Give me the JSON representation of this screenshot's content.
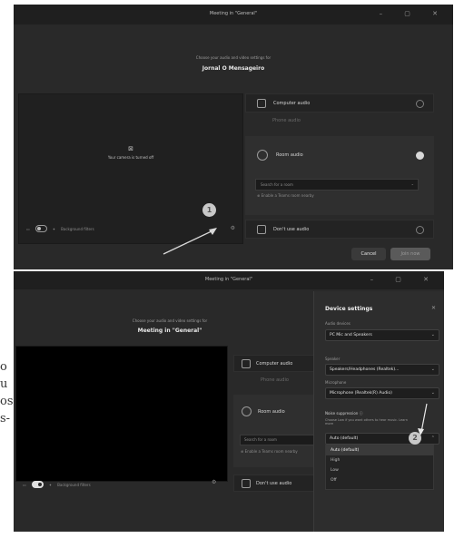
{
  "top": {
    "title": "Meeting in \"General\"",
    "window_buttons": "–  ▢  ✕",
    "subtitle": "Choose your audio and video settings for",
    "meeting_name": "Jornal O Mensageiro",
    "camera_off": "Your camera is turned off",
    "background_filters": "Background filters",
    "options": [
      {
        "label": "Computer audio",
        "selected": false
      },
      {
        "label": "Phone audio",
        "selected": false,
        "faded": true
      },
      {
        "label": "Room audio",
        "selected": true
      },
      {
        "label": "Don't use audio",
        "selected": false
      }
    ],
    "search_room_placeholder": "Search for a room",
    "nearby_rooms": "Enable a Teams room nearby",
    "cancel": "Cancel",
    "join_now": "Join now",
    "step_badge": "1"
  },
  "bottom": {
    "title": "Meeting in \"General\"",
    "subtitle": "Choose your audio and video settings for",
    "meeting_name": "Meeting in \"General\"",
    "background_filters": "Background filters",
    "options": [
      {
        "label": "Computer audio",
        "selected": false
      },
      {
        "label": "Phone audio",
        "selected": false,
        "faded": true
      },
      {
        "label": "Room audio",
        "selected": true
      },
      {
        "label": "Don't use audio",
        "selected": false
      }
    ],
    "search_room_placeholder": "Search for a room",
    "nearby_rooms": "Enable a Teams room nearby",
    "step_badge": "2"
  },
  "device_settings": {
    "heading": "Device settings",
    "audio_devices_label": "Audio devices",
    "audio_devices_value": "PC Mic and Speakers",
    "speaker_label": "Speaker",
    "speaker_value": "Speakers/Headphones (Realtek)...",
    "microphone_label": "Microphone",
    "microphone_value": "Microphone (Realtek(R) Audio)",
    "noise_label": "Noise suppression ⓘ",
    "noise_hint": "Choose Low if you want others to hear music. Learn more",
    "noise_value": "Auto (default)",
    "noise_options": [
      "Auto (default)",
      "High",
      "Low",
      "Off"
    ]
  },
  "side_text": [
    "o",
    "u",
    "os",
    "s-"
  ]
}
